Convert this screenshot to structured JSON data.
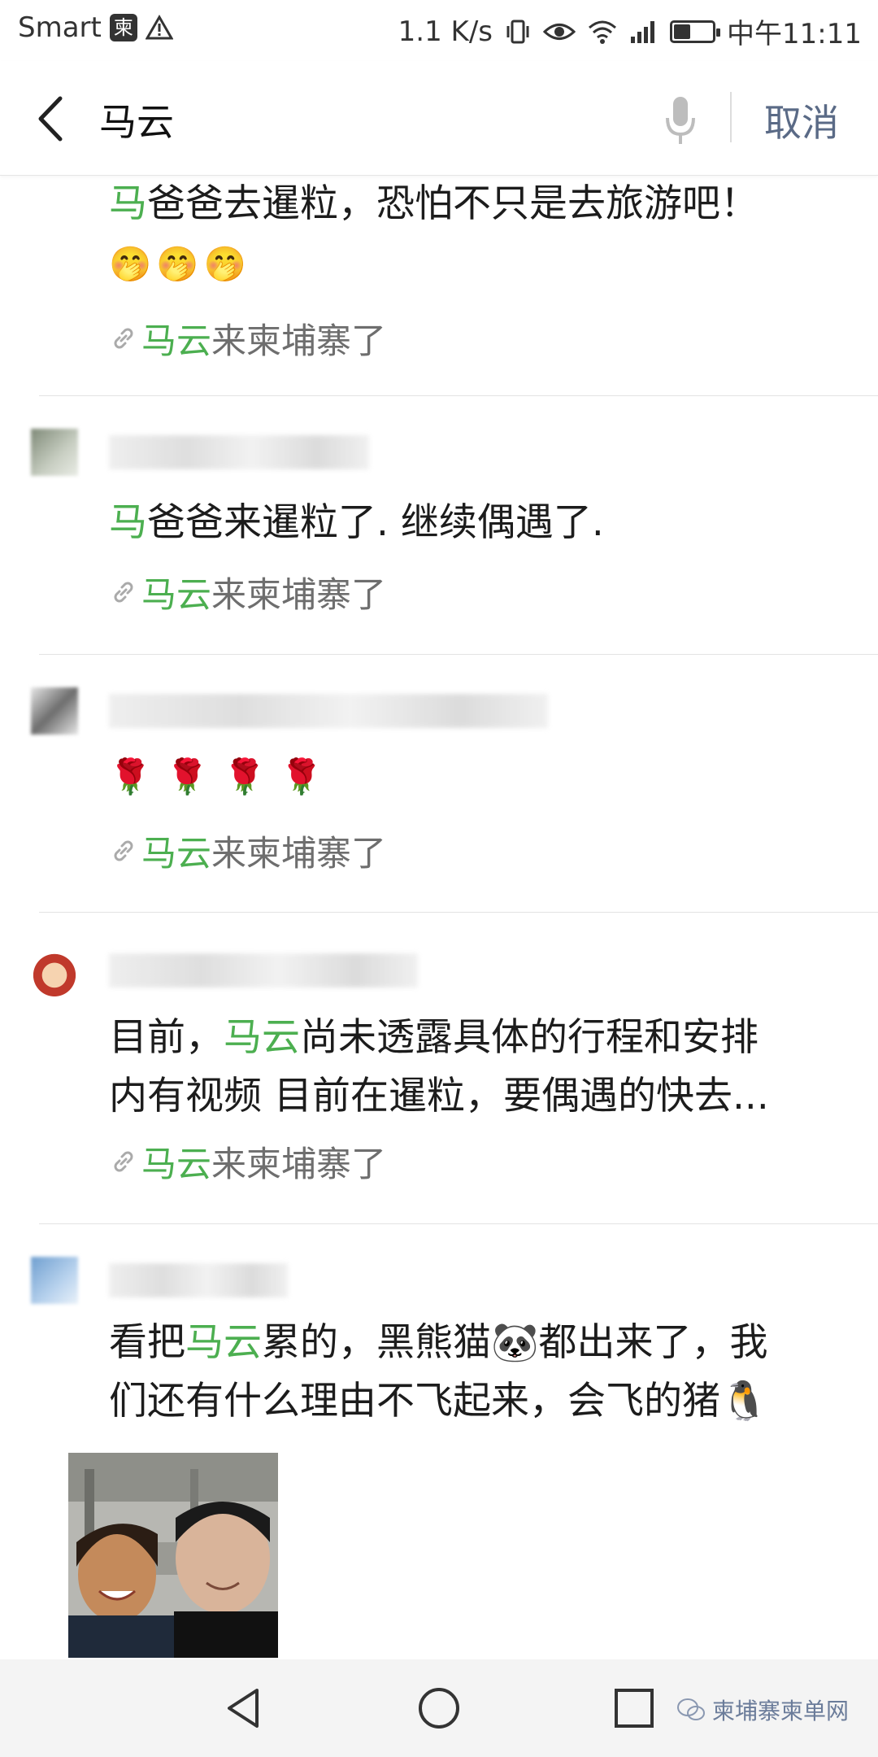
{
  "status_bar": {
    "carrier": "Smart",
    "network_speed": "1.1 K/s",
    "time": "中午11:11"
  },
  "search": {
    "query": "马云",
    "cancel_label": "取消"
  },
  "posts": [
    {
      "text_hl": "马",
      "text_rest": "爸爸去暹粒，恐怕不只是去旅游吧！",
      "emojis": [
        "🤭",
        "🤭",
        "🤭"
      ],
      "source_hl": "马云",
      "source_rest": "来柬埔寨了"
    },
    {
      "text_hl": "马",
      "text_rest": "爸爸来暹粒了. 继续偶遇了.",
      "source_hl": "马云",
      "source_rest": "来柬埔寨了"
    },
    {
      "emojis": [
        "🌹",
        "🌹",
        "🌹",
        "🌹"
      ],
      "source_hl": "马云",
      "source_rest": "来柬埔寨了"
    },
    {
      "text_pre": "目前，",
      "text_hl": "马云",
      "text_rest": "尚未透露具体的行程和安排",
      "text_line2": "内有视频 目前在暹粒，要偶遇的快去...",
      "source_hl": "马云",
      "source_rest": "来柬埔寨了"
    },
    {
      "text_pre": "看把",
      "text_hl": "马云",
      "text_rest": "累的，黑熊猫🐼都出来了，我",
      "text_line2": "们还有什么理由不飞起来，会飞的猪🐧"
    }
  ],
  "watermark": "柬埔寨柬单网"
}
